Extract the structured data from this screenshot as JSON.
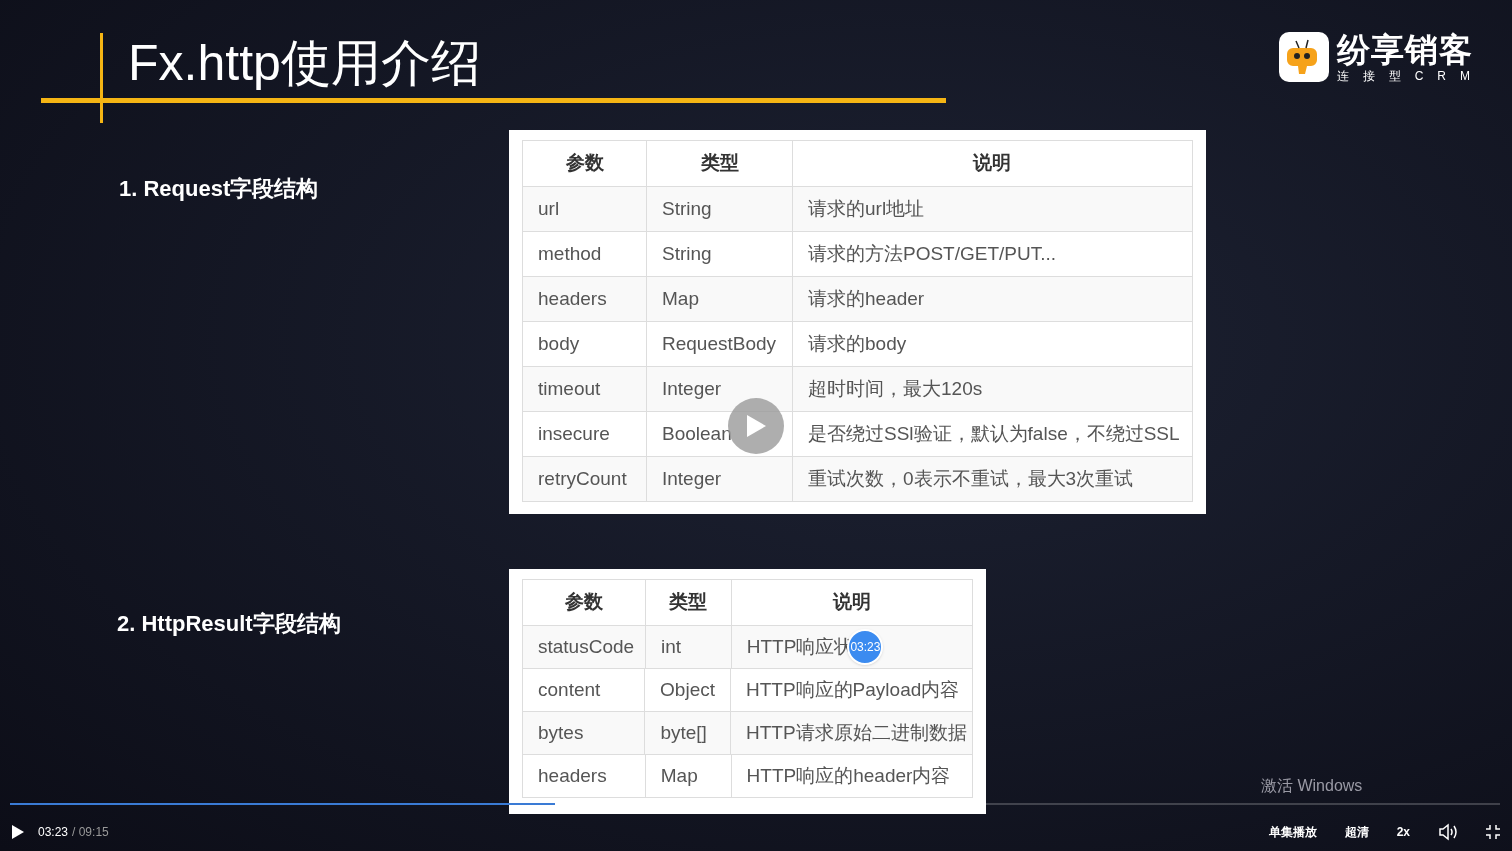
{
  "slide": {
    "title": "Fx.http使用介绍",
    "logo": {
      "name": "纷享销客",
      "tagline": "连接型CRM"
    },
    "sections": [
      {
        "heading": "1. Request字段结构",
        "columns": [
          "参数",
          "类型",
          "说明"
        ],
        "rows": [
          [
            "url",
            "String",
            "请求的url地址"
          ],
          [
            "method",
            "String",
            "请求的方法POST/GET/PUT..."
          ],
          [
            "headers",
            "Map",
            "请求的header"
          ],
          [
            "body",
            "RequestBody",
            "请求的body"
          ],
          [
            "timeout",
            "Integer",
            "超时时间，最大120s"
          ],
          [
            "insecure",
            "Boolean",
            "是否绕过SSl验证，默认为false，不绕过SSL"
          ],
          [
            "retryCount",
            "Integer",
            "重试次数，0表示不重试，最大3次重试"
          ]
        ]
      },
      {
        "heading": "2. HttpResult字段结构",
        "columns": [
          "参数",
          "类型",
          "说明"
        ],
        "rows": [
          [
            "statusCode",
            "int",
            "HTTP响应状"
          ],
          [
            "content",
            "Object",
            "HTTP响应的Payload内容"
          ],
          [
            "bytes",
            "byte[]",
            "HTTP请求原始二进制数据"
          ],
          [
            "headers",
            "Map",
            "HTTP响应的header内容"
          ]
        ]
      }
    ],
    "os_notice": "激活 Windows"
  },
  "player": {
    "seek_bubble": "03:23",
    "progress": {
      "level": 0.366
    },
    "current_time": "03:23",
    "total_time": "/ 09:15",
    "playing": false,
    "controls": [
      "单集播放",
      "超清",
      "2x"
    ]
  }
}
